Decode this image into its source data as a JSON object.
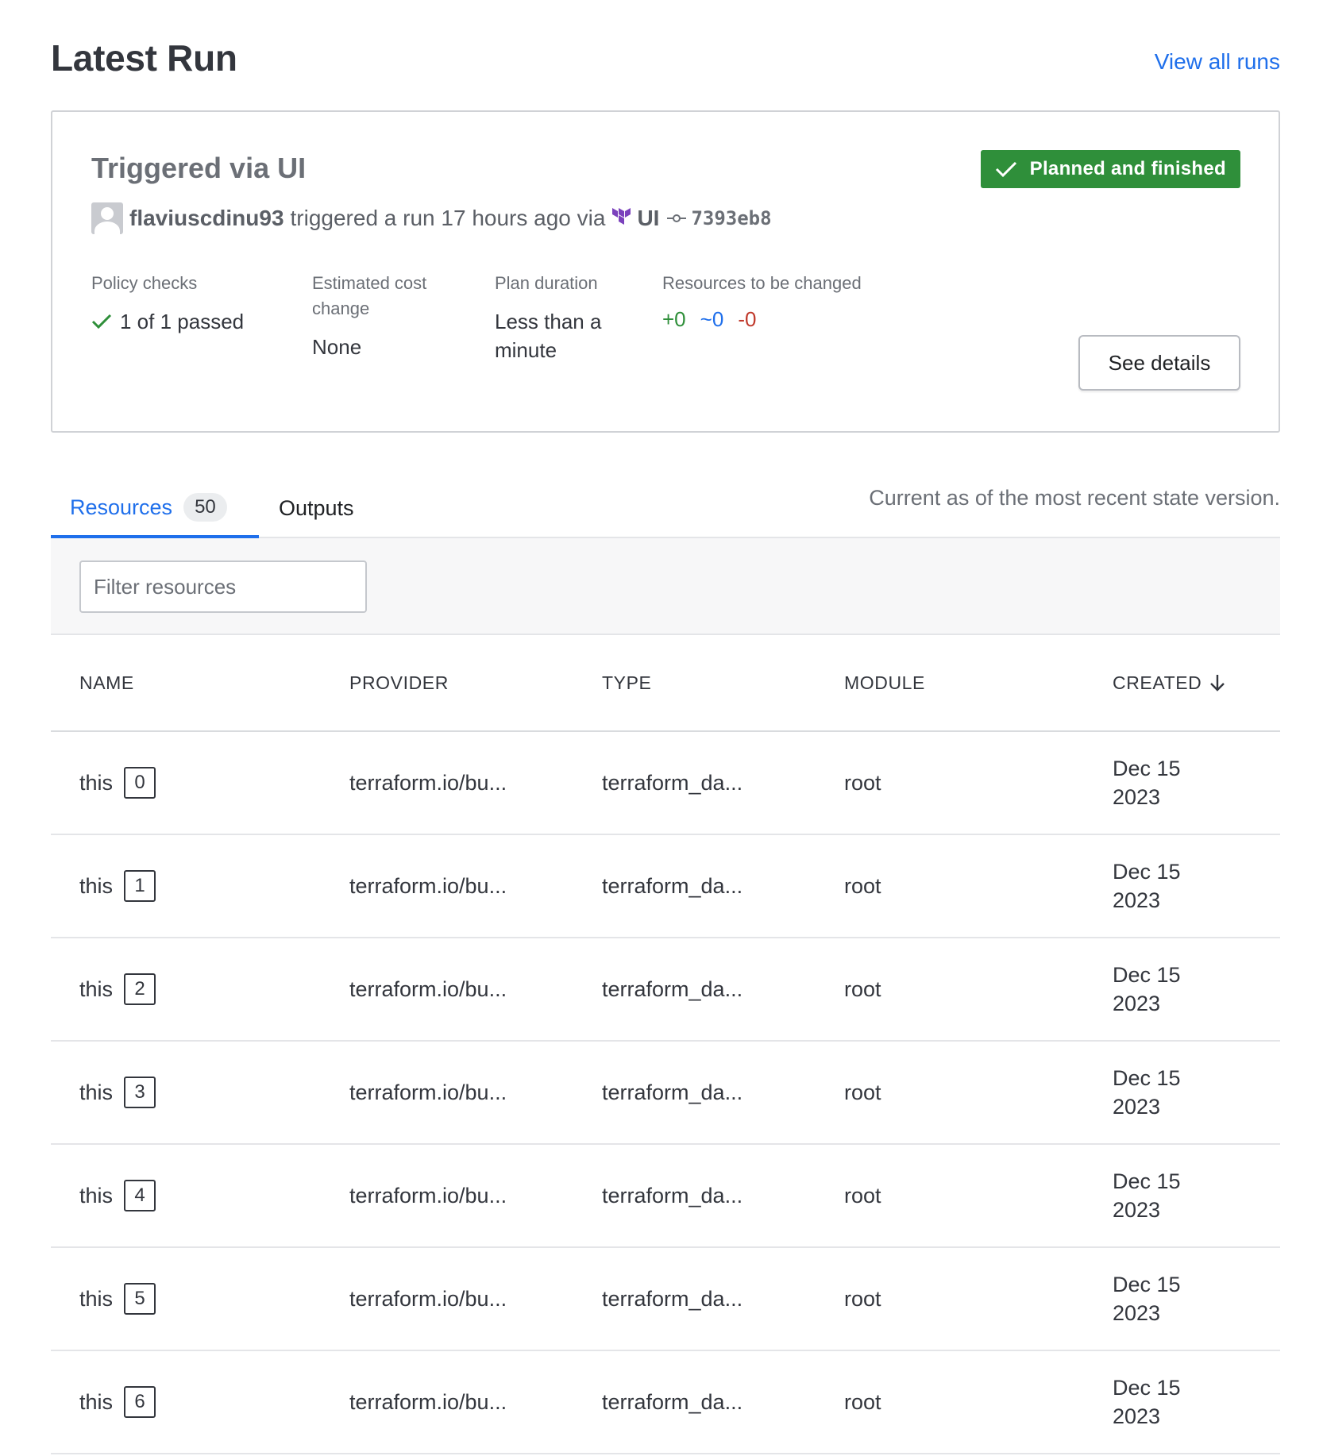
{
  "header": {
    "title": "Latest Run",
    "view_all_link": "View all runs"
  },
  "run": {
    "title": "Triggered via UI",
    "status": "Planned and finished",
    "username": "flaviuscdinu93",
    "action_text": "triggered a run 17 hours ago via",
    "source": "UI",
    "commit": "7393eb8",
    "policy_label": "Policy checks",
    "policy_value": "1 of 1 passed",
    "cost_label": "Estimated cost change",
    "cost_value": "None",
    "duration_label": "Plan duration",
    "duration_value": "Less than a minute",
    "resources_label": "Resources to be changed",
    "resources_add": "+0",
    "resources_change": "~0",
    "resources_destroy": "-0",
    "see_details_label": "See details"
  },
  "tabs": {
    "resources_label": "Resources",
    "resources_count": "50",
    "outputs_label": "Outputs",
    "state_note": "Current as of the most recent state version."
  },
  "filter": {
    "placeholder": "Filter resources"
  },
  "table": {
    "columns": [
      "NAME",
      "PROVIDER",
      "TYPE",
      "MODULE",
      "CREATED"
    ],
    "rows": [
      {
        "name": "this",
        "index": "0",
        "provider": "terraform.io/bu...",
        "type": "terraform_da...",
        "module": "root",
        "created": "Dec 15 2023"
      },
      {
        "name": "this",
        "index": "1",
        "provider": "terraform.io/bu...",
        "type": "terraform_da...",
        "module": "root",
        "created": "Dec 15 2023"
      },
      {
        "name": "this",
        "index": "2",
        "provider": "terraform.io/bu...",
        "type": "terraform_da...",
        "module": "root",
        "created": "Dec 15 2023"
      },
      {
        "name": "this",
        "index": "3",
        "provider": "terraform.io/bu...",
        "type": "terraform_da...",
        "module": "root",
        "created": "Dec 15 2023"
      },
      {
        "name": "this",
        "index": "4",
        "provider": "terraform.io/bu...",
        "type": "terraform_da...",
        "module": "root",
        "created": "Dec 15 2023"
      },
      {
        "name": "this",
        "index": "5",
        "provider": "terraform.io/bu...",
        "type": "terraform_da...",
        "module": "root",
        "created": "Dec 15 2023"
      },
      {
        "name": "this",
        "index": "6",
        "provider": "terraform.io/bu...",
        "type": "terraform_da...",
        "module": "root",
        "created": "Dec 15 2023"
      }
    ]
  },
  "colors": {
    "link": "#1f6feb",
    "success": "#2f8f3a",
    "danger": "#c0392b",
    "terraform_purple": "#7b42bc"
  },
  "icons": [
    "check-icon",
    "avatar-placeholder-icon",
    "terraform-logo-icon",
    "commit-icon",
    "search-icon",
    "arrow-down-icon"
  ]
}
